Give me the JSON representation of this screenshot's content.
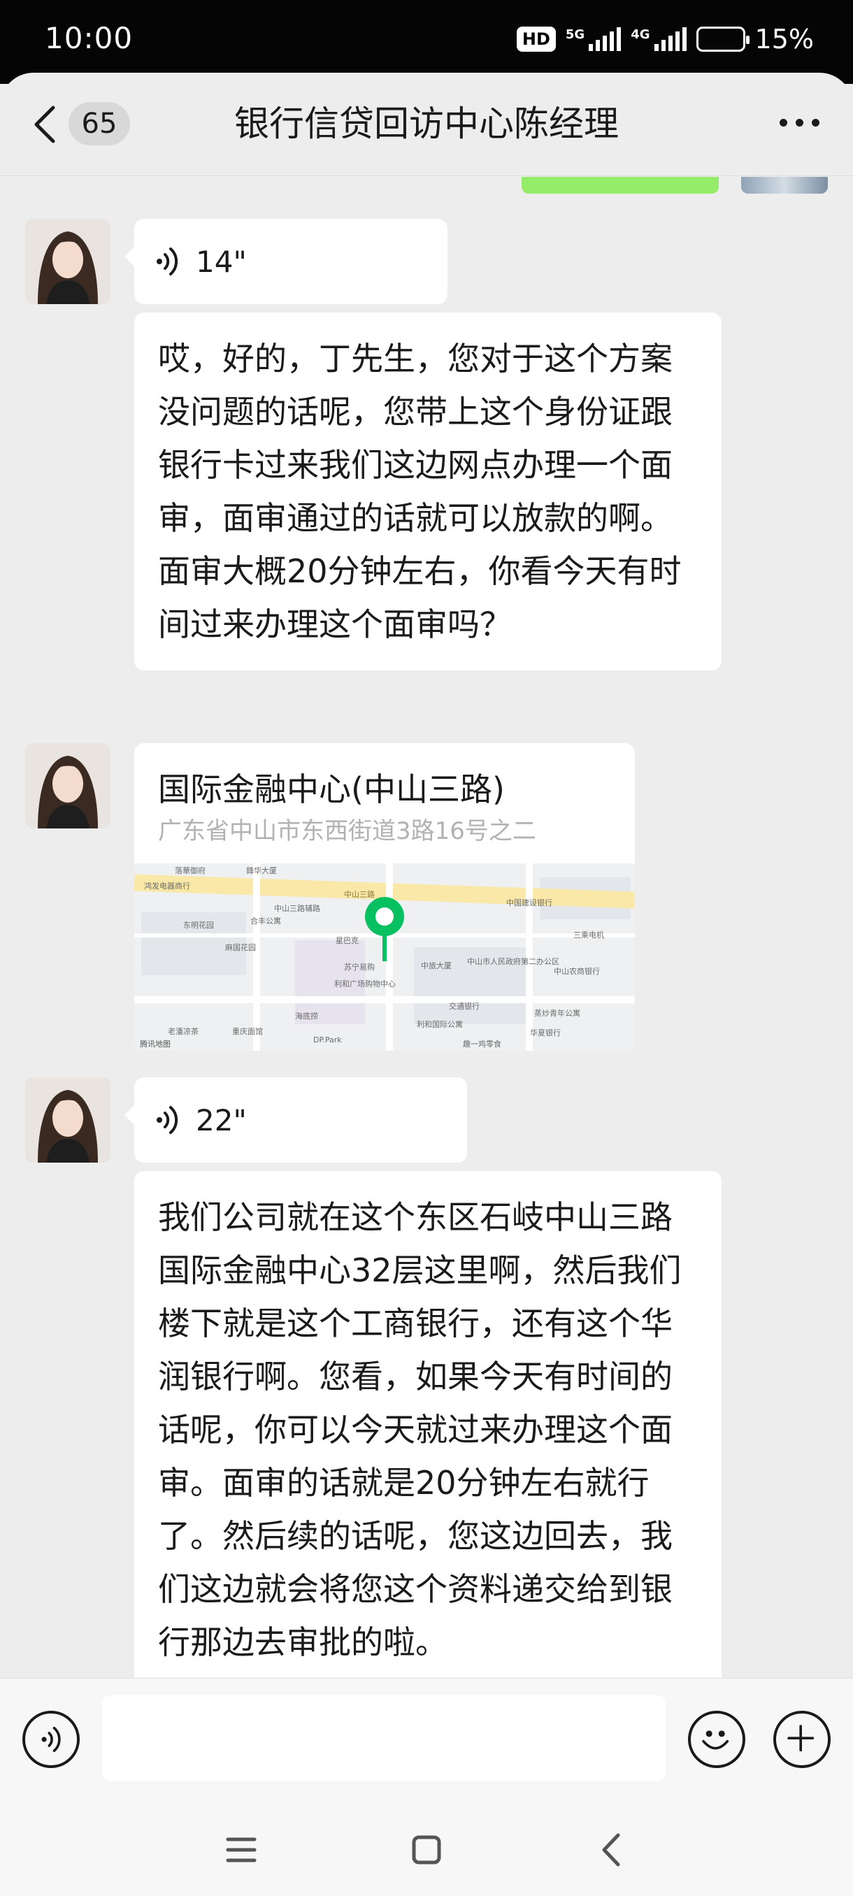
{
  "status_bar": {
    "time": "10:00",
    "hd_label": "HD",
    "net1": "5G",
    "net2": "4G",
    "battery_percent": "15%",
    "battery_level": 0.15,
    "battery_color": "#ff3b30"
  },
  "header": {
    "back_icon": "chevron-left-icon",
    "unread_count": "65",
    "title": "银行信贷回访中心陈经理",
    "more_icon": "more-dots-icon"
  },
  "messages": [
    {
      "type": "voice",
      "duration": "14\""
    },
    {
      "type": "text",
      "text": "哎，好的，丁先生，您对于这个方案没问题的话呢，您带上这个身份证跟银行卡过来我们这边网点办理一个面审，面审通过的话就可以放款的啊。面审大概20分钟左右，你看今天有时间过来办理这个面审吗？"
    },
    {
      "type": "location",
      "title": "国际金融中心(中山三路)",
      "address": "广东省中山市东西街道3路16号之二",
      "map": {
        "pin_color": "#07c160",
        "provider": "腾讯地图",
        "labels": [
          "落華御府",
          "鋒华大厦",
          "鸿发电器商行",
          "中国建设银行",
          "中山三路辅路",
          "东明花园",
          "合丰公寓",
          "星巴克",
          "苏宁易购",
          "中旅大厦",
          "三乘电机",
          "麻国花园",
          "中山市人民政府第二办公区",
          "中山农商银行",
          "利和广场购物中心",
          "利和国际公寓",
          "交通银行",
          "蒸炒青年公寓",
          "海底捞",
          "老潘凉茶",
          "重庆面馆",
          "DP.Park",
          "趣一鸡零食",
          "华夏银行",
          "中山三路"
        ]
      }
    },
    {
      "type": "voice",
      "duration": "22\""
    },
    {
      "type": "text",
      "text": "我们公司就在这个东区石岐中山三路国际金融中心32层这里啊，然后我们楼下就是这个工商银行，还有这个华润银行啊。您看，如果今天有时间的话呢，你可以今天就过来办理这个面审。面审的话就是20分钟左右就行了。然后续的话呢，您这边回去，我们这边就会将您这个资料递交给到银行那边去审批的啦。"
    }
  ],
  "input_bar": {
    "voice_icon": "voice-input-icon",
    "input_value": "",
    "emoji_icon": "emoji-icon",
    "plus_icon": "plus-icon"
  },
  "nav_bar": {
    "menu_icon": "menu-icon",
    "home_icon": "home-square-icon",
    "back_icon": "back-triangle-icon"
  }
}
